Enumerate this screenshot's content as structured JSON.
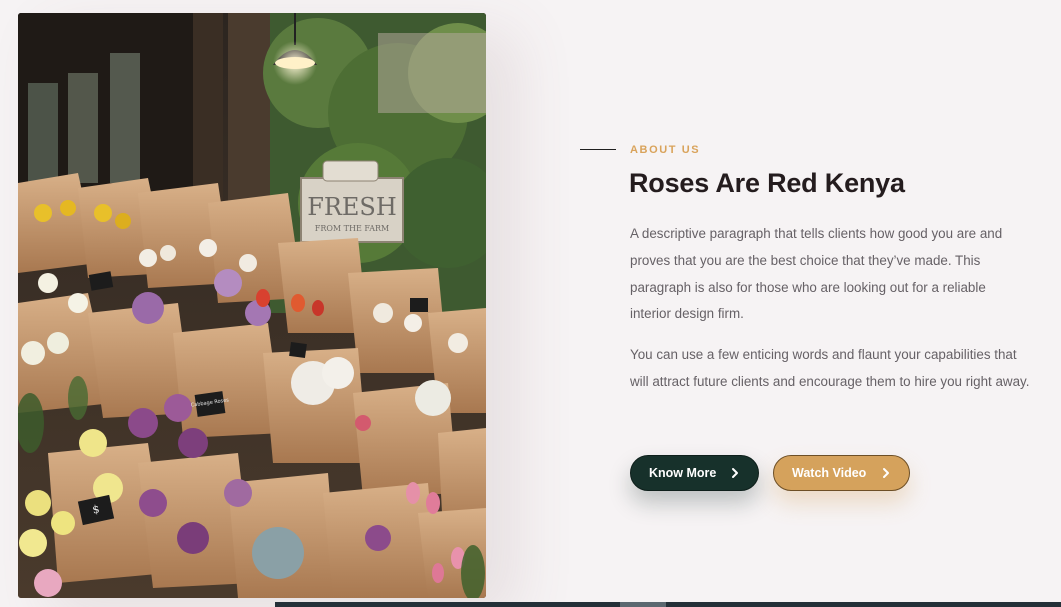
{
  "about": {
    "eyebrow": "ABOUT US",
    "title": "Roses Are Red Kenya",
    "paragraph_1": "A descriptive paragraph that tells clients how good you are and proves that you are the best choice that they’ve made. This paragraph is also for those who are looking out for a reliable interior design firm.",
    "paragraph_2": "You can use a few enticing words and flaunt your capabilities that will attract future clients and encourage them to hire you right away."
  },
  "buttons": {
    "know_more": "Know More",
    "watch_video": "Watch Video"
  },
  "photo": {
    "sign_main": "FRESH",
    "sign_sub": "FROM THE FARM",
    "tag_1": "Cabbage Roses",
    "tag_2": "$"
  },
  "colors": {
    "accent": "#d9a35b",
    "heading": "#241c1e",
    "body_text": "#666166",
    "dark_button": "#17312b",
    "gold_button": "#d5a25c",
    "background": "#f6f3f4"
  },
  "icons": {
    "button_chevron": "chevron-right-icon"
  }
}
